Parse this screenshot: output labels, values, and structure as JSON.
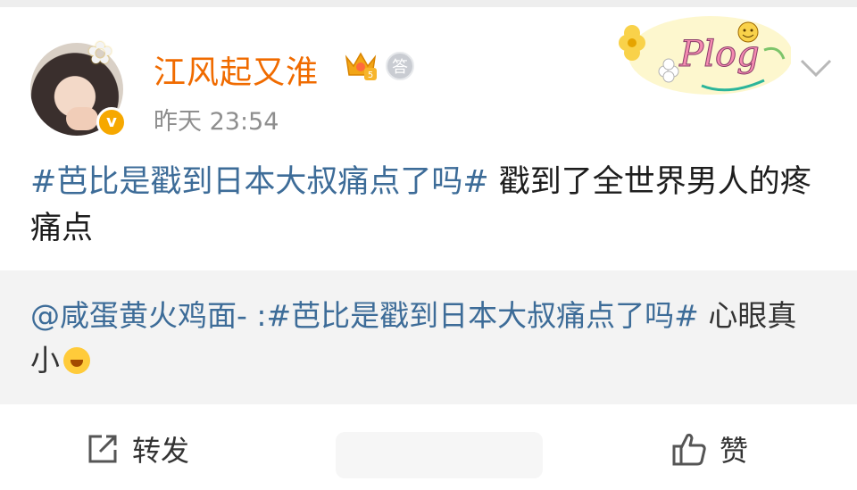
{
  "user": {
    "name": "江风起又淮",
    "verified_badge": "v",
    "level_badge": "5",
    "answer_badge": "答"
  },
  "post": {
    "timestamp": "昨天 23:54",
    "hashtag": "#芭比是戳到日本大叔痛点了吗#",
    "text": " 戳到了全世界男人的疼痛点"
  },
  "quote": {
    "user": "@咸蛋黄火鸡面-",
    "separator": " :",
    "hashtag": "#芭比是戳到日本大叔痛点了吗#",
    "text": " 心眼真小"
  },
  "actions": {
    "repost_label": "转发",
    "like_label": "赞"
  },
  "sticker_text": "Plog",
  "icons": {
    "more": "chevron-down-icon",
    "repost": "repost-icon",
    "like": "thumbs-up-icon",
    "emoji": "laugh-cry-icon"
  },
  "colors": {
    "username": "#f06b00",
    "link": "#3d6c98",
    "timestamp": "#8e8e8e",
    "quote_bg": "#f3f3f3"
  }
}
